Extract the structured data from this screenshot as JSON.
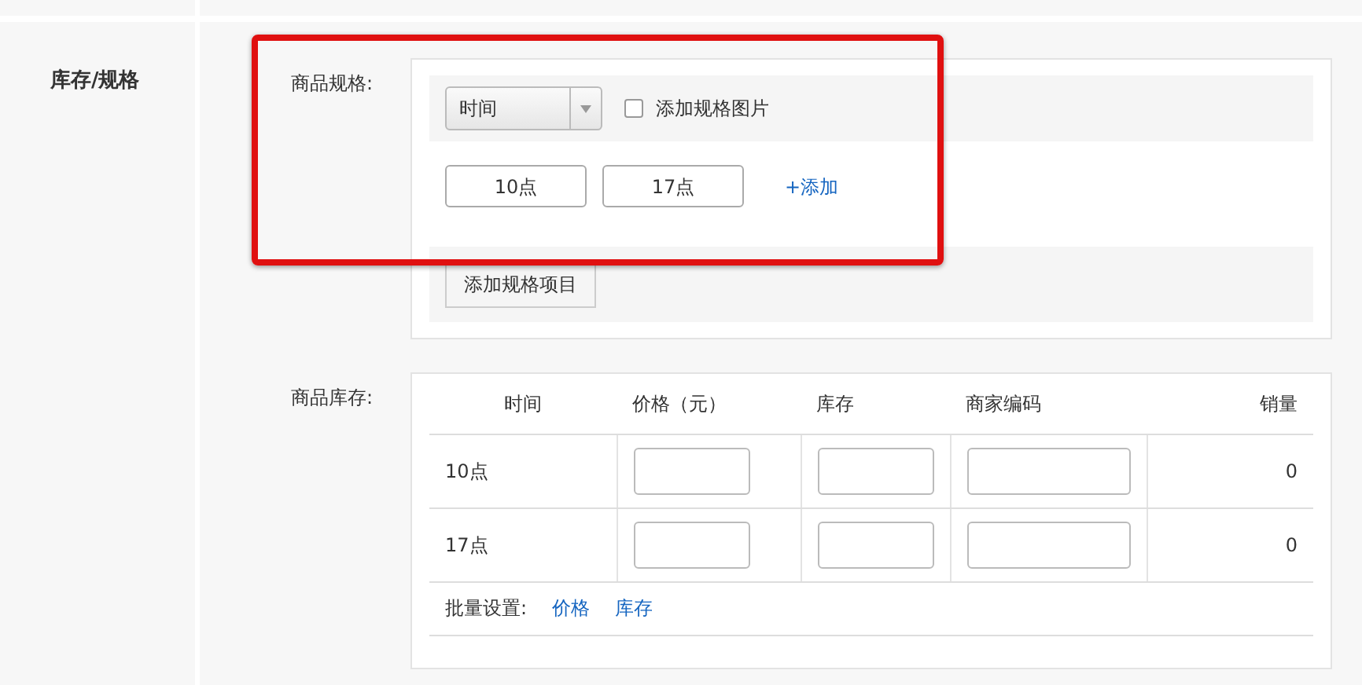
{
  "section": {
    "label": "库存/规格"
  },
  "spec": {
    "label": "商品规格:",
    "group": {
      "select_value": "时间",
      "image_checkbox": {
        "label": "添加规格图片",
        "checked": false
      },
      "values": [
        "10点",
        "17点"
      ],
      "add_link": "+添加"
    },
    "add_item_button": "添加规格项目"
  },
  "stock": {
    "label": "商品库存:",
    "columns": [
      "时间",
      "价格（元）",
      "库存",
      "商家编码",
      "销量"
    ],
    "rows": [
      {
        "name": "10点",
        "sales": "0"
      },
      {
        "name": "17点",
        "sales": "0"
      }
    ],
    "batch": {
      "label": "批量设置:",
      "links": [
        "价格",
        "库存"
      ]
    }
  }
}
